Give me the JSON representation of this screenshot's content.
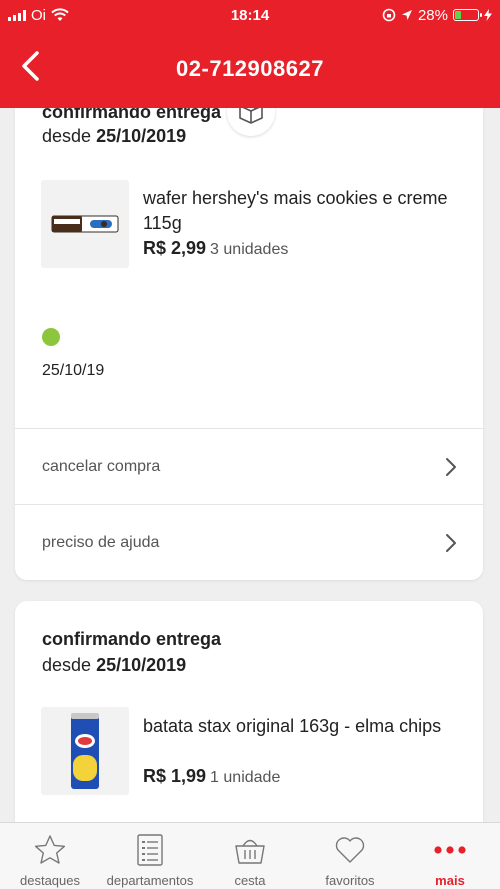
{
  "status_bar": {
    "carrier": "Oi",
    "time": "18:14",
    "battery_percent": "28%",
    "battery_level": 0.28
  },
  "header": {
    "title": "02-712908627"
  },
  "orders": [
    {
      "status_title": "confirmando entrega",
      "since_prefix": "desde",
      "since_date": "25/10/2019",
      "product_name": "wafer hershey's mais cookies e creme 115g",
      "price": "R$ 2,99",
      "units": "3 unidades",
      "timeline_date": "25/10/19",
      "actions": [
        "cancelar compra",
        "preciso de ajuda"
      ]
    },
    {
      "status_title": "confirmando entrega",
      "since_prefix": "desde",
      "since_date": "25/10/2019",
      "product_name": "batata stax original 163g - elma chips",
      "price": "R$ 1,99",
      "units": "1 unidade"
    }
  ],
  "tabs": [
    {
      "label": "destaques",
      "icon": "star-icon"
    },
    {
      "label": "departamentos",
      "icon": "list-icon"
    },
    {
      "label": "cesta",
      "icon": "basket-icon"
    },
    {
      "label": "favoritos",
      "icon": "heart-icon"
    },
    {
      "label": "mais",
      "icon": "more-icon",
      "active": true
    }
  ],
  "colors": {
    "brand_red": "#e8202a",
    "status_green": "#8cc63f"
  }
}
